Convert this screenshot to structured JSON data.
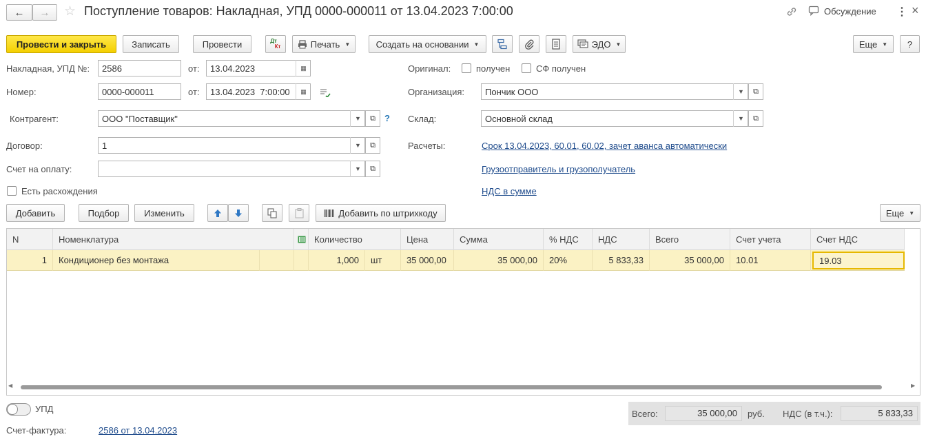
{
  "header": {
    "title": "Поступление товаров: Накладная, УПД 0000-000011 от 13.04.2023 7:00:00",
    "discussion_label": "Обсуждение"
  },
  "toolbar": {
    "post_close": "Провести и закрыть",
    "save": "Записать",
    "post": "Провести",
    "dtkt_dt": "Дт",
    "dtkt_kt": "Кт",
    "print": "Печать",
    "create_based": "Создать на основании",
    "edo": "ЭДО",
    "more": "Еще",
    "help": "?"
  },
  "form": {
    "invoice_label": "Накладная, УПД №:",
    "invoice_value": "2586",
    "from_label": "от:",
    "invoice_date": "13.04.2023",
    "number_label": "Номер:",
    "number_value": "0000-000011",
    "number_date": "13.04.2023  7:00:00",
    "counterparty_label": "Контрагент:",
    "counterparty_value": "ООО \"Поставщик\"",
    "counterparty_help": "?",
    "contract_label": "Договор:",
    "contract_value": "1",
    "payment_account_label": "Счет на оплату:",
    "payment_account_value": "",
    "discrepancies_label": "Есть расхождения",
    "original_label": "Оригинал:",
    "received_label": "получен",
    "sf_received_label": "СФ получен",
    "org_label": "Организация:",
    "org_value": "Пончик ООО",
    "warehouse_label": "Склад:",
    "warehouse_value": "Основной склад",
    "settlements_label": "Расчеты:",
    "settlements_link": "Срок 13.04.2023, 60.01, 60.02, зачет аванса автоматически",
    "shipper_link": "Грузоотправитель и грузополучатель",
    "vat_link": "НДС в сумме"
  },
  "table_toolbar": {
    "add": "Добавить",
    "selection": "Подбор",
    "change": "Изменить",
    "add_barcode": "Добавить по штрихкоду",
    "more": "Еще"
  },
  "table": {
    "columns": [
      "N",
      "Номенклатура",
      "Количество",
      "Цена",
      "Сумма",
      "% НДС",
      "НДС",
      "Всего",
      "Счет учета",
      "Счет НДС"
    ],
    "rows": [
      {
        "n": "1",
        "item": "Кондиционер без монтажа",
        "qty": "1,000",
        "unit": "шт",
        "price": "35 000,00",
        "sum": "35 000,00",
        "vat_rate": "20%",
        "vat": "5 833,33",
        "total": "35 000,00",
        "account": "10.01",
        "vat_account": "19.03"
      }
    ]
  },
  "footer": {
    "upd_label": "УПД",
    "invoice_label": "Счет-фактура:",
    "invoice_link": "2586 от 13.04.2023",
    "total_label": "Всего:",
    "total_value": "35 000,00",
    "currency": "руб.",
    "vat_incl_label": "НДС (в т.ч.):",
    "vat_incl_value": "5 833,33"
  }
}
